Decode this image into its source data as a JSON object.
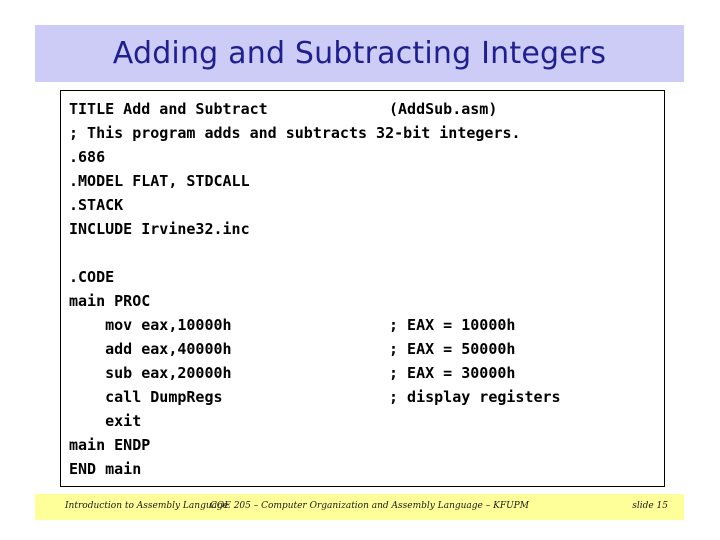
{
  "slide": {
    "title": "Adding and Subtracting Integers",
    "colors": {
      "title_banner_bg": "#ccccf7",
      "title_text": "#1f1f8f",
      "footer_bg": "#ffff99",
      "code_border": "#000000",
      "page_bg": "#ffffff"
    }
  },
  "code": {
    "lines": [
      {
        "src": "TITLE Add and Subtract",
        "comment": "(AddSub.asm)"
      },
      {
        "src": "; This program adds and subtracts 32-bit integers.",
        "comment": ""
      },
      {
        "src": ".686",
        "comment": ""
      },
      {
        "src": ".MODEL FLAT, STDCALL",
        "comment": ""
      },
      {
        "src": ".STACK",
        "comment": ""
      },
      {
        "src": "INCLUDE Irvine32.inc",
        "comment": ""
      },
      {
        "src": "",
        "comment": ""
      },
      {
        "src": ".CODE",
        "comment": ""
      },
      {
        "src": "main PROC",
        "comment": ""
      },
      {
        "src": "    mov eax,10000h",
        "comment": "; EAX = 10000h"
      },
      {
        "src": "    add eax,40000h",
        "comment": "; EAX = 50000h"
      },
      {
        "src": "    sub eax,20000h",
        "comment": "; EAX = 30000h"
      },
      {
        "src": "    call DumpRegs",
        "comment": "; display registers"
      },
      {
        "src": "    exit",
        "comment": ""
      },
      {
        "src": "main ENDP",
        "comment": ""
      },
      {
        "src": "END main",
        "comment": ""
      }
    ]
  },
  "footer": {
    "left": "Introduction to Assembly Language",
    "center": "COE 205 – Computer Organization and Assembly Language – KFUPM",
    "right": "slide 15"
  }
}
